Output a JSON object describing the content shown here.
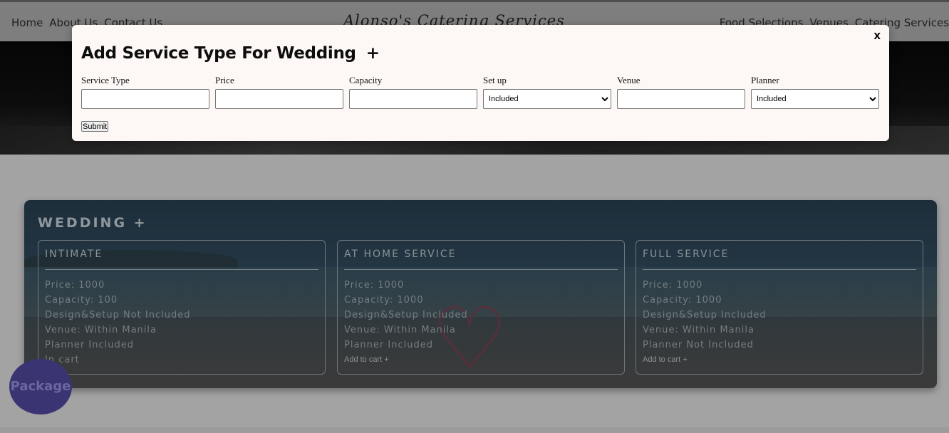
{
  "nav": {
    "left": [
      "Home",
      "About Us",
      "Contact Us"
    ],
    "brand": "Alonso's Catering Services",
    "right": [
      "Food Selections",
      "Venues",
      "Catering Services"
    ]
  },
  "wedding": {
    "title": "WEDDING +",
    "cards": [
      {
        "title": "INTIMATE",
        "lines": [
          "Price: 1000",
          "Capacity: 100",
          "Design&Setup Not Included",
          "Venue: Within Manila",
          "Planner Included",
          "In cart"
        ],
        "cart": ""
      },
      {
        "title": "AT HOME SERVICE",
        "lines": [
          "Price: 1000",
          "Capacity: 1000",
          "Design&Setup Included",
          "Venue: Within Manila",
          "Planner Included"
        ],
        "cart": "Add to cart +"
      },
      {
        "title": "FULL SERVICE",
        "lines": [
          "Price: 1000",
          "Capacity: 1000",
          "Design&Setup Included",
          "Venue: Within Manila",
          "Planner Not Included"
        ],
        "cart": "Add to cart +"
      }
    ]
  },
  "package_button": "Package",
  "modal": {
    "close": "x",
    "title": "Add Service Type For Wedding",
    "title_plus": "+",
    "fields": [
      {
        "label": "Service Type",
        "type": "text",
        "value": ""
      },
      {
        "label": "Price",
        "type": "text",
        "value": ""
      },
      {
        "label": "Capacity",
        "type": "text",
        "value": ""
      },
      {
        "label": "Set up",
        "type": "select",
        "value": "Included"
      },
      {
        "label": "Venue",
        "type": "text",
        "value": ""
      },
      {
        "label": "Planner",
        "type": "select",
        "value": "Included"
      }
    ],
    "submit": "Submit"
  },
  "colors": {
    "modal_bg": "#fdf8f6",
    "package_bg": "#3b3472",
    "overlay": "#a3a3a3"
  }
}
